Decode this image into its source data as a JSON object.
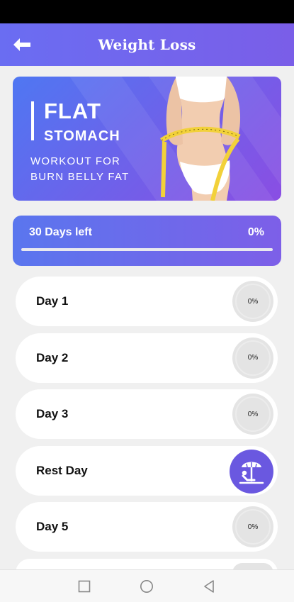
{
  "header": {
    "title": "Weight Loss",
    "back_icon": "arrow-left-icon"
  },
  "banner": {
    "title_line1": "FLAT",
    "title_line2": "STOMACH",
    "subtitle_line1": "WORKOUT FOR",
    "subtitle_line2": "BURN BELLY FAT",
    "image": "woman-measuring-waist-illustration"
  },
  "progress": {
    "label": "30 Days left",
    "percent_text": "0%",
    "value": 0
  },
  "days": [
    {
      "label": "Day 1",
      "percent": "0%",
      "type": "workout"
    },
    {
      "label": "Day 2",
      "percent": "0%",
      "type": "workout"
    },
    {
      "label": "Day 3",
      "percent": "0%",
      "type": "workout"
    },
    {
      "label": "Rest Day",
      "percent": "",
      "type": "rest",
      "icon": "beach-umbrella-icon"
    },
    {
      "label": "Day 5",
      "percent": "0%",
      "type": "workout"
    }
  ],
  "nav": {
    "recent_icon": "square-icon",
    "home_icon": "circle-icon",
    "back_icon": "triangle-back-icon"
  },
  "colors": {
    "accent": "#6a6df2",
    "accent_dark": "#7a5ee8",
    "rest_badge": "#6a58e0",
    "ring": "#e4e4e4"
  }
}
